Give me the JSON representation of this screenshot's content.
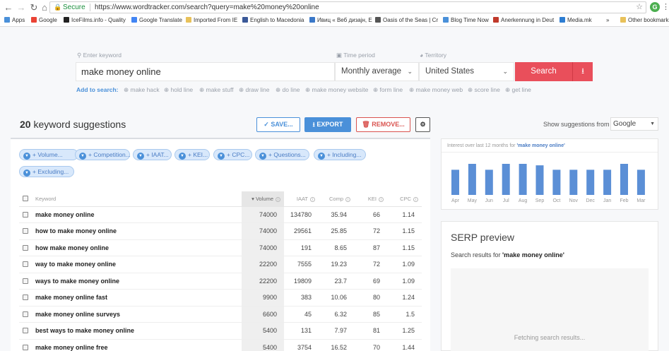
{
  "browser": {
    "secure_label": "Secure",
    "url": "https://www.wordtracker.com/search?query=make%20money%20online",
    "ext_label": "G",
    "bookmarks": [
      {
        "label": "Apps",
        "color": "#4a90d9"
      },
      {
        "label": "Google",
        "color": "#ea4335"
      },
      {
        "label": "IceFilms.info - Quality",
        "color": "#222222"
      },
      {
        "label": "Google Translate",
        "color": "#4285f4"
      },
      {
        "label": "Imported From IE",
        "color": "#e8c15a"
      },
      {
        "label": "English to Macedonia",
        "color": "#3b5998"
      },
      {
        "label": "Ивиц « Веб дизајн, Е",
        "color": "#3b78c8"
      },
      {
        "label": "Oasis of the Seas | Cr",
        "color": "#555555"
      },
      {
        "label": "Blog Time Now",
        "color": "#4a90d9"
      },
      {
        "label": "Anerkennung in Deut",
        "color": "#c0392b"
      },
      {
        "label": "Media.mk",
        "color": "#2d7dd2"
      },
      {
        "label": "»",
        "color": ""
      },
      {
        "label": "Other bookmarks",
        "color": "#e8c15a"
      }
    ]
  },
  "search": {
    "keyword_label": "Enter keyword",
    "keyword_value": "make money online",
    "period_label": "Time period",
    "period_value": "Monthly average",
    "territory_label": "Territory",
    "territory_value": "United States",
    "search_button": "Search",
    "add_to_search_label": "Add to search:",
    "suggestions": [
      "make hack",
      "hold line",
      "make stuff",
      "draw line",
      "do line",
      "make money website",
      "form line",
      "make money web",
      "score line",
      "get line"
    ]
  },
  "results": {
    "count": "20",
    "count_label": "keyword suggestions",
    "save_label": "SAVE...",
    "export_label": "EXPORT",
    "remove_label": "REMOVE...",
    "show_suggestions_label": "Show suggestions from",
    "source_value": "Google"
  },
  "filters": [
    "+ Volume...",
    "+ Competition...",
    "+ IAAT...",
    "+ KEI...",
    "+ CPC...",
    "+ Questions...",
    "+ Including...",
    "+ Excluding..."
  ],
  "table": {
    "columns": [
      "Keyword",
      "Volume",
      "IAAT",
      "Comp",
      "KEI",
      "CPC"
    ],
    "rows": [
      {
        "keyword": "make money online",
        "volume": "74000",
        "iaat": "134780",
        "comp": "35.94",
        "kei": "66",
        "cpc": "1.14"
      },
      {
        "keyword": "how to make money online",
        "volume": "74000",
        "iaat": "29561",
        "comp": "25.85",
        "kei": "72",
        "cpc": "1.15"
      },
      {
        "keyword": "how make money online",
        "volume": "74000",
        "iaat": "191",
        "comp": "8.65",
        "kei": "87",
        "cpc": "1.15"
      },
      {
        "keyword": "way to make money online",
        "volume": "22200",
        "iaat": "7555",
        "comp": "19.23",
        "kei": "72",
        "cpc": "1.09"
      },
      {
        "keyword": "ways to make money online",
        "volume": "22200",
        "iaat": "19809",
        "comp": "23.7",
        "kei": "69",
        "cpc": "1.09"
      },
      {
        "keyword": "make money online fast",
        "volume": "9900",
        "iaat": "383",
        "comp": "10.06",
        "kei": "80",
        "cpc": "1.24"
      },
      {
        "keyword": "make money online surveys",
        "volume": "6600",
        "iaat": "45",
        "comp": "6.32",
        "kei": "85",
        "cpc": "1.5"
      },
      {
        "keyword": "best ways to make money online",
        "volume": "5400",
        "iaat": "131",
        "comp": "7.97",
        "kei": "81",
        "cpc": "1.25"
      },
      {
        "keyword": "make money online free",
        "volume": "5400",
        "iaat": "3754",
        "comp": "16.52",
        "kei": "70",
        "cpc": "1.44"
      }
    ]
  },
  "trend": {
    "title_prefix": "Interest over last 12 months for",
    "title_keyword": "'make money online'",
    "bar_color": "#5b8fd6",
    "months": [
      "Apr",
      "May",
      "Jun",
      "Jul",
      "Aug",
      "Sep",
      "Oct",
      "Nov",
      "Dec",
      "Jan",
      "Feb",
      "Mar"
    ],
    "values": [
      34,
      42,
      34,
      42,
      42,
      40,
      34,
      34,
      34,
      34,
      42,
      34
    ]
  },
  "serp": {
    "title": "SERP preview",
    "subtitle_prefix": "Search results for",
    "subtitle_keyword": "'make money online'",
    "loading": "Fetching search results..."
  }
}
